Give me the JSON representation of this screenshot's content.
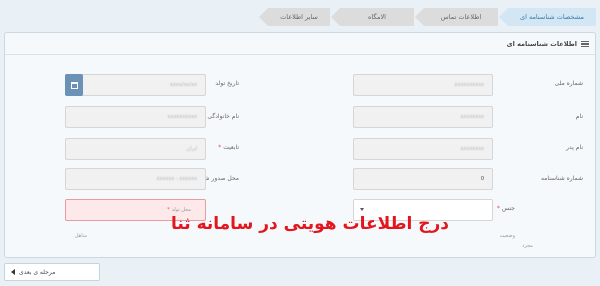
{
  "steps": [
    {
      "label": "مشخصات شناسنامه ای",
      "active": true
    },
    {
      "label": "اطلاعات تماس",
      "active": false
    },
    {
      "label": "الامگاه",
      "active": false
    },
    {
      "label": "سایر اطلاعات",
      "active": false
    }
  ],
  "panel": {
    "title": "اطلاعات شناسنامه ای"
  },
  "fields": {
    "national_code": {
      "label": "شماره ملی",
      "value": "xxxxxxxxxx"
    },
    "birth_date": {
      "label": "تاریخ تولد",
      "value": "xxxx/xx/xx"
    },
    "first_name": {
      "label": "نام",
      "value": "xxxxxxxx"
    },
    "last_name": {
      "label": "نام خانوادگی",
      "value": "xxxxxxxxxx"
    },
    "father_name": {
      "label": "نام پدر",
      "value": "xxxxxxxx"
    },
    "nationality": {
      "label": "تابعیت",
      "required": "*",
      "value": "ایران"
    },
    "id_number": {
      "label": "شماره شناسنامه",
      "value": "0"
    },
    "issue_place": {
      "label": "محل صدور شناسنامه",
      "required": "*",
      "value": "xxxxxx - xxxxxx"
    },
    "gender": {
      "label": "جنس",
      "required": "*",
      "value": ""
    },
    "birth_place": {
      "label": "محل تولد",
      "required": "*",
      "value": ""
    },
    "marital": {
      "label": "وضعیت",
      "opt1": "مجرد",
      "opt2": "متاهل"
    }
  },
  "overlay_title": "درج اطلاعات هویتی در سامانه ثنا",
  "next_button": "مرحله ی بعدی"
}
